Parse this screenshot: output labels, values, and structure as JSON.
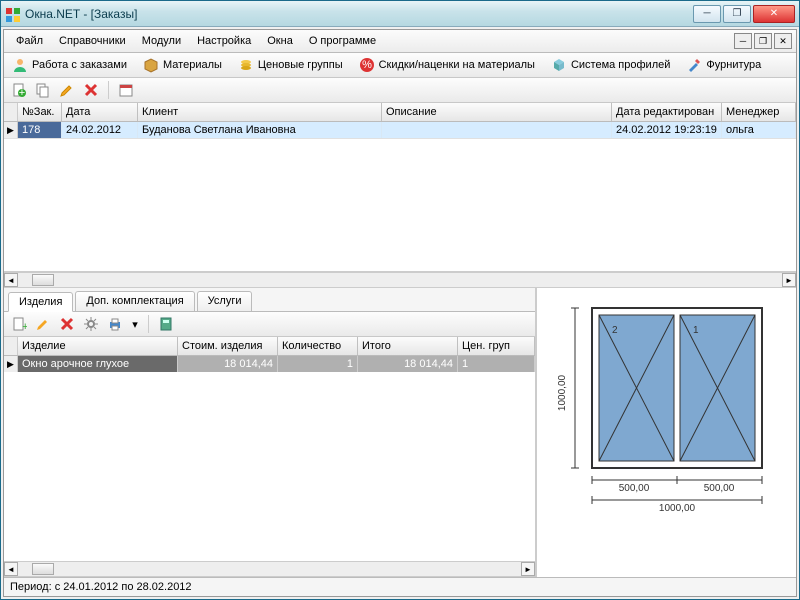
{
  "title": "Окна.NET - [Заказы]",
  "menu": {
    "file": "Файл",
    "references": "Справочники",
    "modules": "Модули",
    "settings": "Настройка",
    "windows": "Окна",
    "about": "О программе"
  },
  "toolbar": {
    "orders": "Работа с заказами",
    "materials": "Материалы",
    "price_groups": "Ценовые группы",
    "discounts": "Скидки/наценки на материалы",
    "profile_system": "Система профилей",
    "furniture": "Фурнитура"
  },
  "orders_grid": {
    "cols": {
      "num": "№Зак.",
      "date": "Дата",
      "client": "Клиент",
      "desc": "Описание",
      "edited": "Дата редактирован",
      "manager": "Менеджер"
    },
    "row": {
      "num": "178",
      "date": "24.02.2012",
      "client": "Буданова Светлана Ивановна",
      "desc": "",
      "edited": "24.02.2012 19:23:19",
      "manager": "ольга"
    }
  },
  "tabs": {
    "products": "Изделия",
    "extras": "Доп. комплектация",
    "services": "Услуги"
  },
  "products_grid": {
    "cols": {
      "product": "Изделие",
      "cost": "Стоим. изделия",
      "qty": "Количество",
      "total": "Итого",
      "pgroup": "Цен. груп"
    },
    "row": {
      "product": "Окно арочное глухое",
      "cost": "18 014,44",
      "qty": "1",
      "total": "18 014,44",
      "pgroup": "1"
    }
  },
  "drawing": {
    "width": "1000,00",
    "height": "1000,00",
    "half": "500,00",
    "sash1": "1",
    "sash2": "2"
  },
  "status": "Период: с 24.01.2012 по 28.02.2012",
  "colors": {
    "selection": "#d6ecff",
    "pane": "#7fa8d0"
  }
}
